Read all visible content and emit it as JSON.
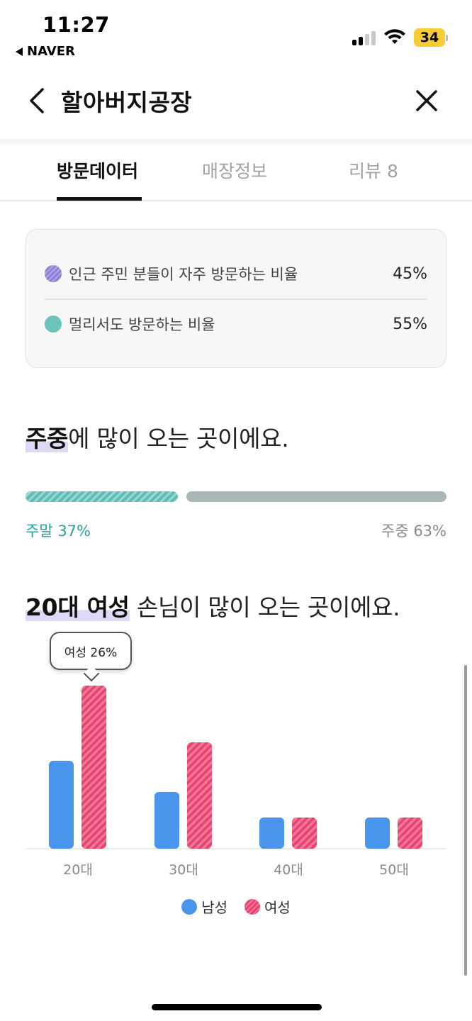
{
  "status_bar": {
    "time": "11:27",
    "back_app": "NAVER",
    "battery": "34",
    "battery_color": "#f7cc34"
  },
  "header": {
    "title": "할아버지공장",
    "back_icon": "chevron-left-icon",
    "close_icon": "close-icon"
  },
  "tabs": [
    {
      "label": "방문데이터",
      "active": true
    },
    {
      "label": "매장정보",
      "active": false
    },
    {
      "label": "리뷰 8",
      "active": false
    }
  ],
  "visit_ratio": [
    {
      "label": "인근 주민 분들이 자주 방문하는 비율",
      "value": "45%",
      "color": "#8f7ed6"
    },
    {
      "label": "멀리서도 방문하는 비율",
      "value": "55%",
      "color": "#6cc4bd"
    }
  ],
  "weekday_section": {
    "headline_strong": "주중",
    "headline_rest": "에 많이 오는 곳이에요.",
    "weekend_label": "주말 37%",
    "weekday_label": "주중 63%",
    "weekend_share": 0.37,
    "weekday_share": 0.63,
    "weekend_color": "#5ebdb4",
    "weekday_color": "#a9b8b7"
  },
  "age_section": {
    "headline_strong": "20대 여성",
    "headline_rest": " 손님이 많이 오는 곳이에요.",
    "tooltip": "여성 26%"
  },
  "chart_data": {
    "type": "bar",
    "categories": [
      "20대",
      "30대",
      "40대",
      "50대"
    ],
    "series": [
      {
        "name": "남성",
        "color": "#4a95ec",
        "values": [
          14,
          9,
          5,
          5
        ]
      },
      {
        "name": "여성",
        "color": "#e8436f",
        "values": [
          26,
          17,
          5,
          5
        ]
      }
    ],
    "ylim": [
      0,
      26
    ],
    "legend": "bottom-center"
  },
  "legend": {
    "male": "남성",
    "female": "여성"
  }
}
